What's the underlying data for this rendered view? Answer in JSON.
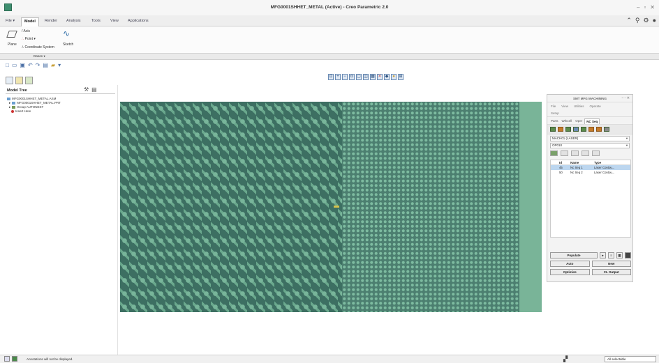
{
  "window": {
    "title": "MFG0001SHHET_METAL (Active) - Creo Parametric 2.0"
  },
  "menu_tabs": [
    {
      "label": "File ▾",
      "active": false
    },
    {
      "label": "Model",
      "active": true
    },
    {
      "label": "Render",
      "active": false
    },
    {
      "label": "Analysis",
      "active": false
    },
    {
      "label": "Tools",
      "active": false
    },
    {
      "label": "View",
      "active": false
    },
    {
      "label": "Applications",
      "active": false
    }
  ],
  "ribbon": {
    "axis_label": "Axis",
    "point_label": "Point ▾",
    "plane_label": "Plane",
    "sketch_label": "Sketch",
    "csys_label": "Coordinate System",
    "group_label": "Datum ▾"
  },
  "model_tree": {
    "title": "Model Tree",
    "items": [
      {
        "label": "MFG0001SHHET_METAL.ASM"
      },
      {
        "label": "MFG0001SHHET_METAL.PRT"
      },
      {
        "label": "Group AUTONEST"
      },
      {
        "label": "Insert Here"
      }
    ]
  },
  "mfg_panel": {
    "title": "SMT MFG MACHINING",
    "menu": [
      "File",
      "View",
      "Utilities",
      "Operate"
    ],
    "setup_label": "Setup",
    "tabs": [
      {
        "label": "Parts",
        "active": false
      },
      {
        "label": "Wrkcell",
        "active": false
      },
      {
        "label": "Oper",
        "active": false
      },
      {
        "label": "NC Seq",
        "active": true
      }
    ],
    "machine_field": "MACH01 (LASER)",
    "operation_field": "OP010",
    "columns": [
      "Id",
      "Name",
      "Type"
    ],
    "rows": [
      {
        "id": "45",
        "name": "Nc Seq 1",
        "type": "Laser Contou...",
        "selected": true
      },
      {
        "id": "50",
        "name": "Nc Seq 2",
        "type": "Laser Contou...",
        "selected": false
      }
    ],
    "buttons": {
      "populate": "Populate",
      "auto": "Auto",
      "new": "New",
      "optimize": "Optimize",
      "cl_output": "CL Output"
    }
  },
  "status": {
    "message": "Annotations will not be displayed.",
    "filter": "All selectable"
  },
  "colors": {
    "canvas_bg": "#5f9e83",
    "parts_dark": "#3d6f62",
    "parts_light": "#78b59a"
  }
}
